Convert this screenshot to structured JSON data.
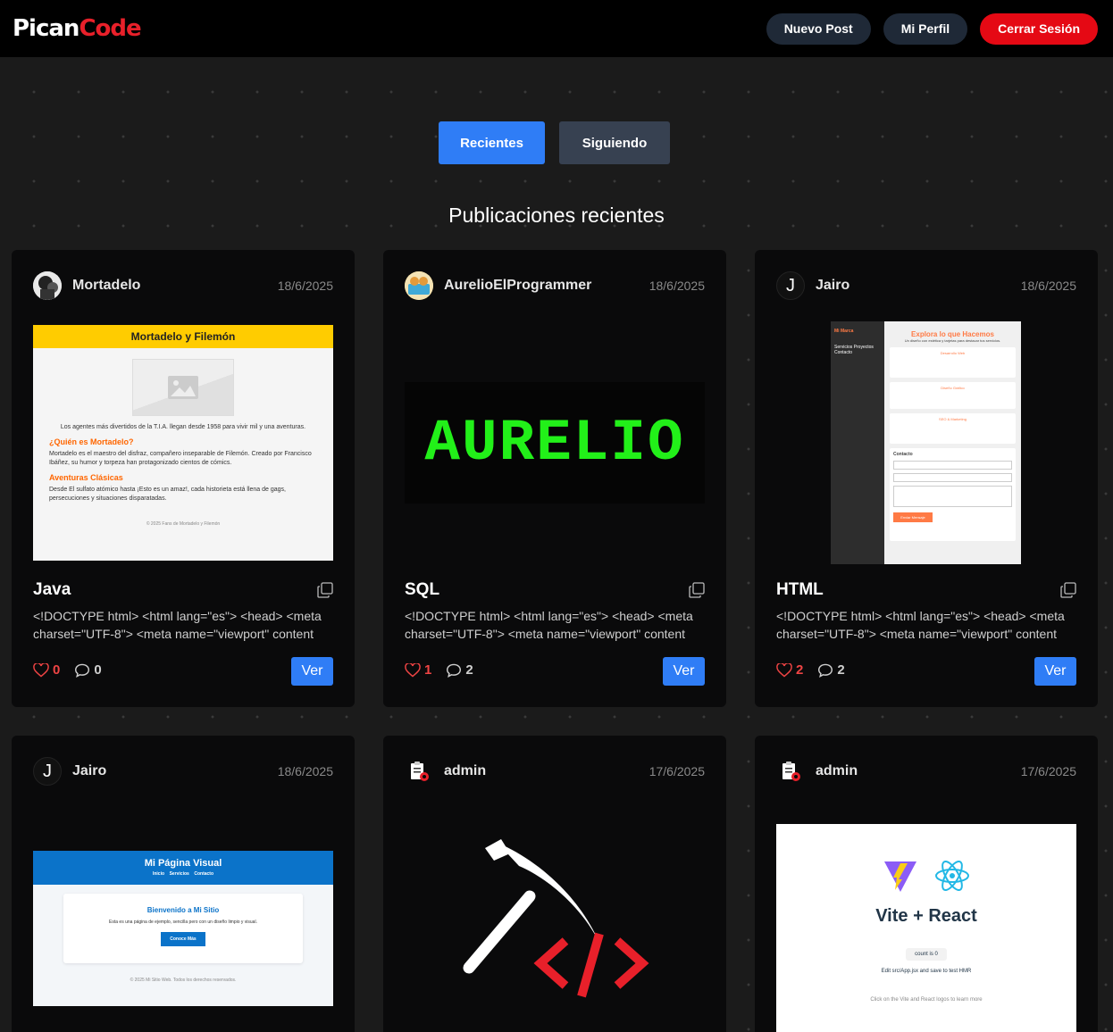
{
  "navbar": {
    "logo_part1": "Pican",
    "logo_part2": "Code",
    "new_post": "Nuevo Post",
    "profile": "Mi Perfil",
    "logout": "Cerrar Sesión"
  },
  "tabs": {
    "recent": "Recientes",
    "following": "Siguiendo"
  },
  "section_title": "Publicaciones recientes",
  "action_label": "Ver",
  "colors": {
    "accent": "#2f7df6",
    "danger": "#e50914",
    "like": "#ef4444",
    "brand_red": "#e8202a"
  },
  "posts": [
    {
      "author": "Mortadelo",
      "date": "18/6/2025",
      "title": "Java",
      "snippet": "<!DOCTYPE html> <html lang=\"es\"> <head> <meta charset=\"UTF-8\"> <meta name=\"viewport\" content",
      "likes": "0",
      "comments": "0",
      "preview": {
        "header": "Mortadelo y Filemón",
        "tagline": "Los agentes más divertidos de la T.I.A. llegan desde 1958 para vivir mil y una aventuras.",
        "h1": "¿Quién es Mortadelo?",
        "p1": "Mortadelo es el maestro del disfraz, compañero inseparable de Filemón. Creado por Francisco Ibáñez, su humor y torpeza han protagonizado cientos de cómics.",
        "h2": "Aventuras Clásicas",
        "p2": "Desde El sulfato atómico hasta ¡Esto es un amaz!, cada historieta está llena de gags, persecuciones y situaciones disparatadas.",
        "footer": "© 2025 Fans de Mortadelo y Filemón"
      }
    },
    {
      "author": "AurelioElProgrammer",
      "date": "18/6/2025",
      "title": "SQL",
      "snippet": "<!DOCTYPE html> <html lang=\"es\"> <head> <meta charset=\"UTF-8\"> <meta name=\"viewport\" content",
      "likes": "1",
      "comments": "2",
      "preview": {
        "text": "AURELIO"
      }
    },
    {
      "author": "Jairo",
      "avatar_letter": "J",
      "date": "18/6/2025",
      "title": "HTML",
      "snippet": "<!DOCTYPE html> <html lang=\"es\"> <head> <meta charset=\"UTF-8\"> <meta name=\"viewport\" content",
      "likes": "2",
      "comments": "2",
      "preview": {
        "brand": "Mi Marca",
        "nav": "Servicios  Proyectos  Contacto",
        "heading": "Explora lo que Hacemos",
        "sub": "Un diseño con estética y tarjetas para destacar tus servicios.",
        "card1": "Desarrollo Web",
        "card2": "Diseño Gráfico",
        "card3": "SEO & Marketing",
        "contact": "Contacto",
        "send": "Enviar Mensaje"
      }
    },
    {
      "author": "Jairo",
      "avatar_letter": "J",
      "date": "18/6/2025",
      "preview": {
        "title": "Mi Página Visual",
        "nav": "Inicio    Servicios    Contacto",
        "welcome": "Bienvenido a Mi Sitio",
        "desc": "Esta es una página de ejemplo, sencilla pero con un diseño limpio y visual.",
        "button": "Conoce Más",
        "footer": "© 2025 Mi Sitio Web. Todos los derechos reservados."
      }
    },
    {
      "author": "admin",
      "date": "17/6/2025"
    },
    {
      "author": "admin",
      "date": "17/6/2025",
      "preview": {
        "title": "Vite + React",
        "count": "count is 0",
        "edit": "Edit src/App.jsx and save to test HMR",
        "hint": "Click on the Vite and React logos to learn more"
      }
    }
  ]
}
